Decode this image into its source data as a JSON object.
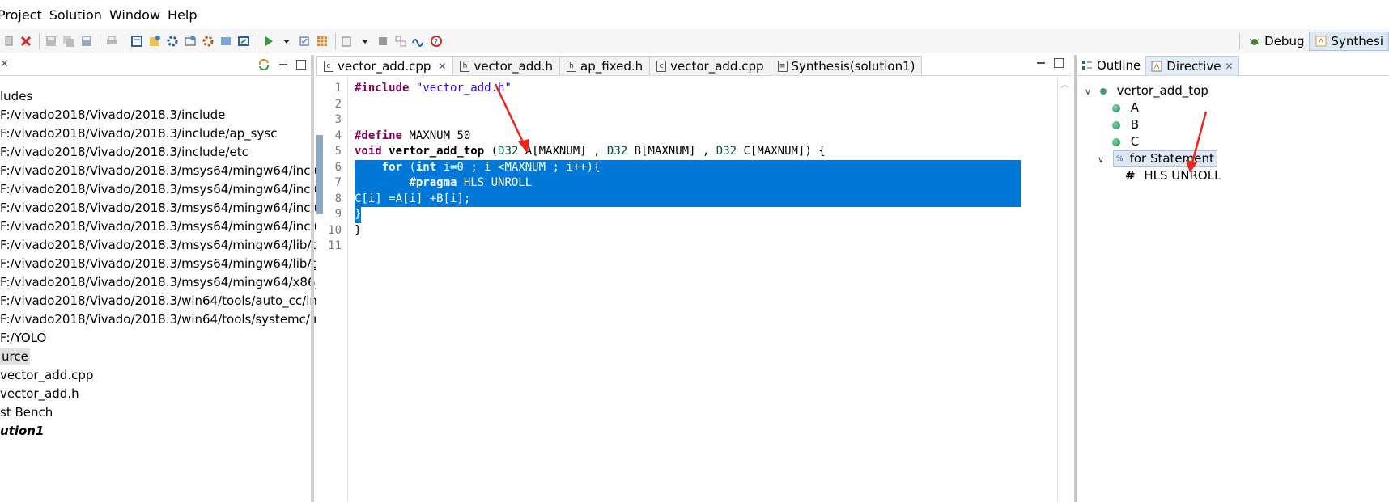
{
  "menu": [
    "Project",
    "Solution",
    "Window",
    "Help"
  ],
  "perspectives": {
    "debug_label": "Debug",
    "synthesis_label": "Synthesi"
  },
  "explorer": {
    "items": [
      "ludes",
      "F:/vivado2018/Vivado/2018.3/include",
      "F:/vivado2018/Vivado/2018.3/include/ap_sysc",
      "F:/vivado2018/Vivado/2018.3/include/etc",
      "F:/vivado2018/Vivado/2018.3/msys64/mingw64/inclu",
      "F:/vivado2018/Vivado/2018.3/msys64/mingw64/inclu",
      "F:/vivado2018/Vivado/2018.3/msys64/mingw64/inclu",
      "F:/vivado2018/Vivado/2018.3/msys64/mingw64/inclu",
      "F:/vivado2018/Vivado/2018.3/msys64/mingw64/lib/g",
      "F:/vivado2018/Vivado/2018.3/msys64/mingw64/lib/g",
      "F:/vivado2018/Vivado/2018.3/msys64/mingw64/x86_",
      "F:/vivado2018/Vivado/2018.3/win64/tools/auto_cc/in",
      "F:/vivado2018/Vivado/2018.3/win64/tools/systemc/ir",
      "F:/YOLO",
      "urce",
      "vector_add.cpp",
      "vector_add.h",
      "st Bench",
      "ution1"
    ]
  },
  "editor": {
    "tabs": [
      "vector_add.cpp",
      "vector_add.h",
      "ap_fixed.h",
      "vector_add.cpp",
      "Synthesis(solution1)"
    ],
    "lines": [
      {
        "n": "1"
      },
      {
        "n": "2"
      },
      {
        "n": "3"
      },
      {
        "n": "4"
      },
      {
        "n": "5"
      },
      {
        "n": "6"
      },
      {
        "n": "7"
      },
      {
        "n": "8"
      },
      {
        "n": "9"
      },
      {
        "n": "10"
      },
      {
        "n": "11"
      }
    ],
    "code": {
      "l1_kw": "#include",
      "l1_str": "\"vector_add.h\"",
      "l4_kw": "#define",
      "l4_rest": " MAXNUM 50",
      "l5_void": "void",
      "l5_name": " vertor_add_top",
      "l5_rest1": " (",
      "l5_t1": "D32",
      "l5_rest2": " A[MAXNUM] , ",
      "l5_t2": "D32",
      "l5_rest3": " B[MAXNUM] , ",
      "l5_t3": "D32",
      "l5_rest4": " C[MAXNUM]) {",
      "l6_indent": "    ",
      "l6_kw": "for",
      "l6_rest1": " (",
      "l6_int": "int",
      "l6_rest2": " i=0 ; i <MAXNUM ; i++){",
      "l7_indent": "        ",
      "l7_kw": "#pragma",
      "l7_rest": " HLS UNROLL",
      "l8": "C[i] =A[i] +B[i];",
      "l9": "}",
      "l10": "}"
    }
  },
  "right_panel": {
    "tabs": {
      "outline": "Outline",
      "directive": "Directive"
    },
    "tree": {
      "top": "vertor_add_top",
      "a": "A",
      "b": "B",
      "c": "C",
      "for": "for Statement",
      "unroll": "HLS UNROLL"
    }
  },
  "colors": {
    "selection": "#0078d7",
    "keyword": "#7f0055",
    "string": "#2a00ff",
    "annotation_arrow": "#e8261c"
  }
}
